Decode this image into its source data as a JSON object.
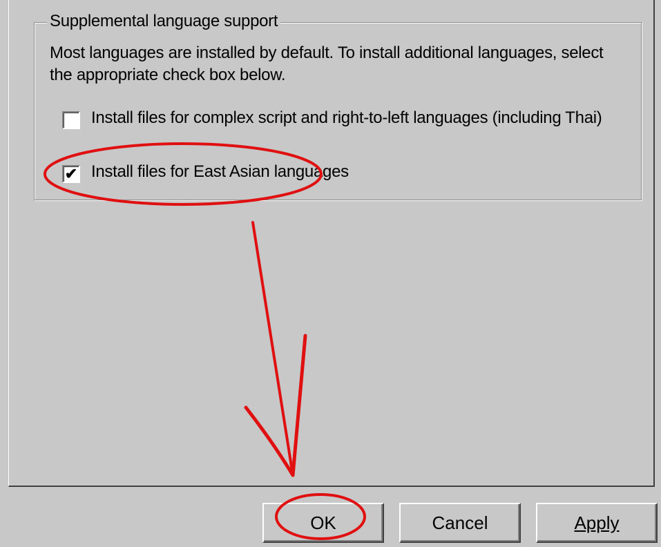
{
  "group": {
    "title": "Supplemental language support",
    "description": "Most languages are installed by default. To install additional languages, select the appropriate check box below."
  },
  "options": [
    {
      "label": "Install files for complex script and right-to-left languages (including Thai)",
      "checked": false
    },
    {
      "label": "Install files for East Asian languages",
      "checked": true
    }
  ],
  "check_glyph": "✔",
  "buttons": {
    "ok": "OK",
    "cancel": "Cancel",
    "apply": "Apply"
  },
  "annotation_color": "#e01010"
}
